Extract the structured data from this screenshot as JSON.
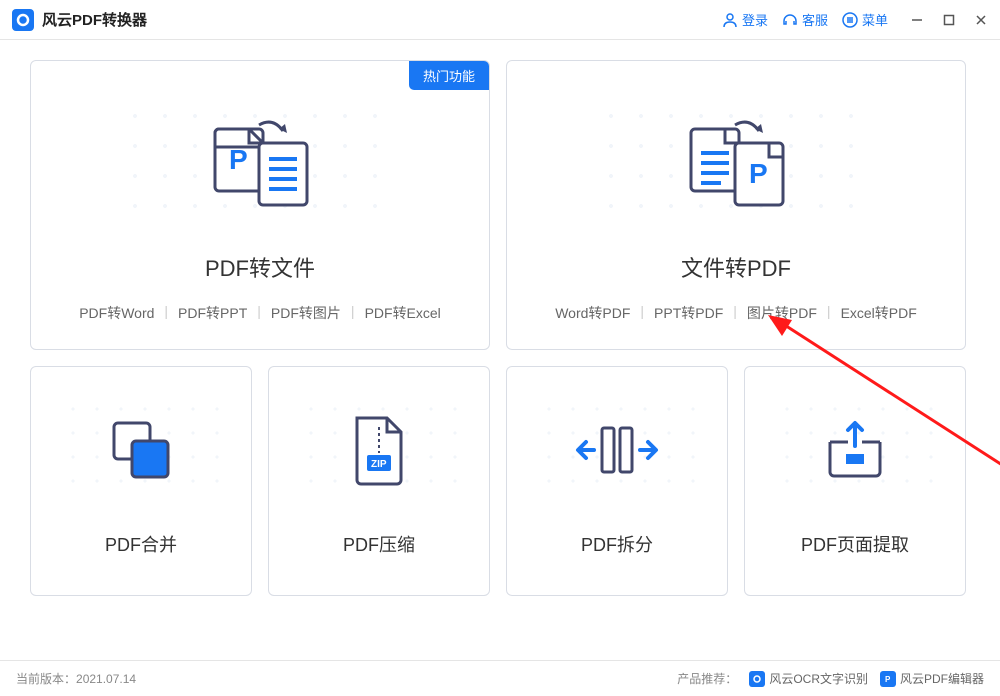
{
  "titlebar": {
    "app_name": "风云PDF转换器",
    "login": "登录",
    "support": "客服",
    "menu": "菜单"
  },
  "cards": {
    "pdf_to_file": {
      "badge": "热门功能",
      "title": "PDF转文件",
      "subs": [
        "PDF转Word",
        "PDF转PPT",
        "PDF转图片",
        "PDF转Excel"
      ]
    },
    "file_to_pdf": {
      "title": "文件转PDF",
      "subs": [
        "Word转PDF",
        "PPT转PDF",
        "图片转PDF",
        "Excel转PDF"
      ]
    },
    "merge": {
      "title": "PDF合并"
    },
    "compress": {
      "title": "PDF压缩"
    },
    "split": {
      "title": "PDF拆分"
    },
    "extract": {
      "title": "PDF页面提取"
    }
  },
  "footer": {
    "version_label": "当前版本：",
    "version": "2021.07.14",
    "recommend_label": "产品推荐：",
    "rec1": "风云OCR文字识别",
    "rec2": "风云PDF编辑器"
  }
}
